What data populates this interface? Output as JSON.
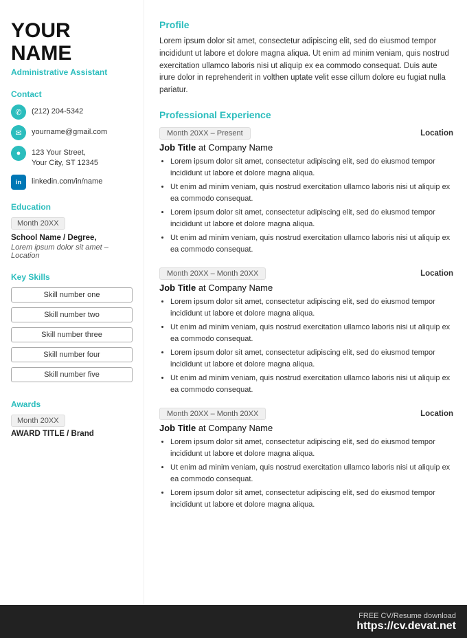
{
  "sidebar": {
    "name_line1": "YOUR",
    "name_line2": "NAME",
    "job_title": "Administrative Assistant",
    "sections": {
      "contact_header": "Contact",
      "phone": "(212) 204-5342",
      "email": "yourname@gmail.com",
      "address_line1": "123 Your Street,",
      "address_line2": "Your City, ST 12345",
      "linkedin": "linkedin.com/in/name",
      "education_header": "Education",
      "edu_date": "Month 20XX",
      "edu_school": "School Name / Degree,",
      "edu_detail": "Lorem ipsum dolor sit amet – Location",
      "skills_header": "Key Skills",
      "skills": [
        "Skill number one",
        "Skill number two",
        "Skill number three",
        "Skill number four",
        "Skill number five"
      ],
      "awards_header": "Awards",
      "award_date": "Month 20XX",
      "award_title": "AWARD TITLE / Brand"
    }
  },
  "main": {
    "profile_header": "Profile",
    "profile_text": "Lorem ipsum dolor sit amet, consectetur adipiscing elit, sed do eiusmod tempor incididunt ut labore et dolore magna aliqua. Ut enim ad minim veniam, quis nostrud exercitation ullamco laboris nisi ut aliquip ex ea commodo consequat. Duis aute irure dolor in reprehenderit in volthen uptate velit esse cillum dolore eu fugiat nulla pariatur.",
    "experience_header": "Professional Experience",
    "experiences": [
      {
        "date": "Month 20XX – Present",
        "location": "Location",
        "job_title": "Job Title",
        "company": "Company Name",
        "bullets": [
          "Lorem ipsum dolor sit amet, consectetur adipiscing elit, sed do eiusmod tempor incididunt ut labore et dolore magna aliqua.",
          "Ut enim ad minim veniam, quis nostrud exercitation ullamco laboris nisi ut aliquip ex ea commodo consequat.",
          "Lorem ipsum dolor sit amet, consectetur adipiscing elit, sed do eiusmod tempor incididunt ut labore et dolore magna aliqua.",
          "Ut enim ad minim veniam, quis nostrud exercitation ullamco laboris nisi ut aliquip ex ea commodo consequat."
        ]
      },
      {
        "date": "Month 20XX – Month 20XX",
        "location": "Location",
        "job_title": "Job Title",
        "company": "Company Name",
        "bullets": [
          "Lorem ipsum dolor sit amet, consectetur adipiscing elit, sed do eiusmod tempor incididunt ut labore et dolore magna aliqua.",
          "Ut enim ad minim veniam, quis nostrud exercitation ullamco laboris nisi ut aliquip ex ea commodo consequat.",
          "Lorem ipsum dolor sit amet, consectetur adipiscing elit, sed do eiusmod tempor incididunt ut labore et dolore magna aliqua.",
          "Ut enim ad minim veniam, quis nostrud exercitation ullamco laboris nisi ut aliquip ex ea commodo consequat."
        ]
      },
      {
        "date": "Month 20XX – Month 20XX",
        "location": "Location",
        "job_title": "Job Title",
        "company": "Company Name",
        "bullets": [
          "Lorem ipsum dolor sit amet, consectetur adipiscing elit, sed do eiusmod tempor incididunt ut labore et dolore magna aliqua.",
          "Ut enim ad minim veniam, quis nostrud exercitation ullamco laboris nisi ut aliquip ex ea commodo consequat.",
          "Lorem ipsum dolor sit amet, consectetur adipiscing elit, sed do eiusmod tempor incididunt ut labore et dolore magna aliqua."
        ]
      }
    ]
  },
  "footer": {
    "small_text": "FREE CV/Resume download",
    "url": "https://cv.devat.net"
  }
}
